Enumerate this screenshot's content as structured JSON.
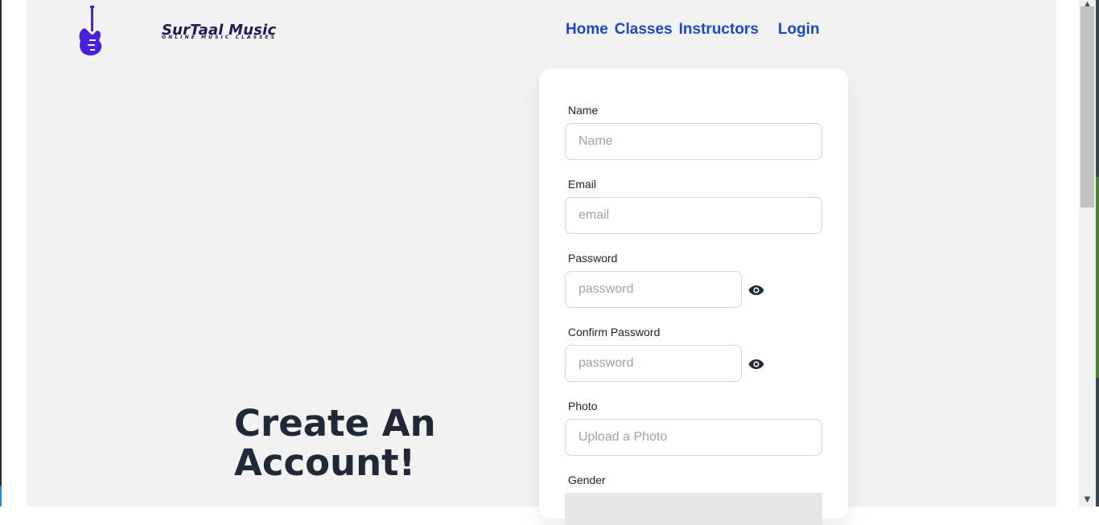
{
  "logo": {
    "title": "SurTaal Music",
    "subtitle": "ONLINE MUSIC CLASSES",
    "icon": "guitar-icon",
    "color": "#4b1fe0"
  },
  "nav": {
    "home": "Home",
    "classes": "Classes",
    "instructors": "Instructors",
    "login": "Login",
    "color": "#1b47c8"
  },
  "hero": {
    "line1": "Create An",
    "line2": "Account!"
  },
  "form": {
    "name_label": "Name",
    "name_placeholder": "Name",
    "email_label": "Email",
    "email_placeholder": "email",
    "password_label": "Password",
    "password_placeholder": "password",
    "confirm_label": "Confirm Password",
    "confirm_placeholder": "password",
    "photo_label": "Photo",
    "photo_placeholder": "Upload a Photo",
    "gender_label": "Gender",
    "eye_icon": "eye-icon"
  },
  "colors": {
    "page_bg": "#f2f2f2",
    "heading": "#1f2937"
  }
}
